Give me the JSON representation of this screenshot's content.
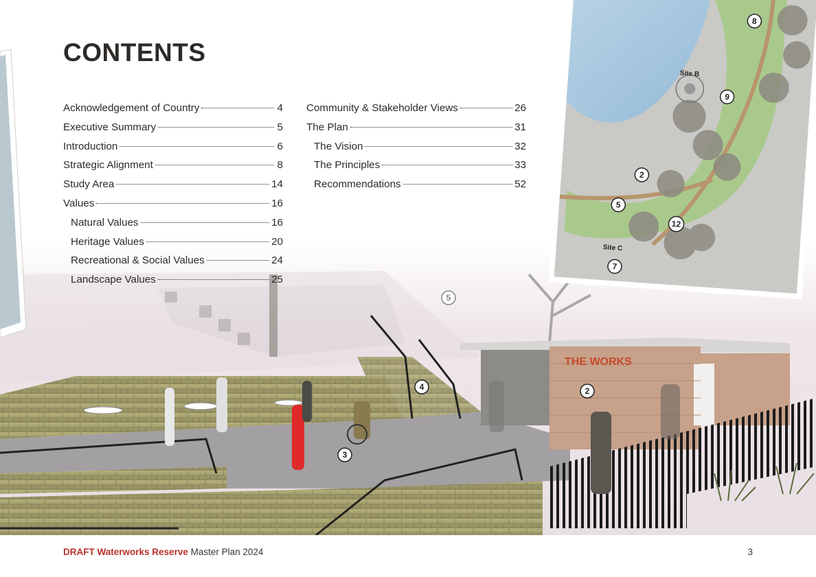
{
  "heading": "CONTENTS",
  "toc_left": [
    {
      "title": "Acknowledgement of Country",
      "page": "4",
      "sub": false
    },
    {
      "title": "Executive Summary",
      "page": "5",
      "sub": false
    },
    {
      "title": "Introduction",
      "page": "6",
      "sub": false
    },
    {
      "title": "Strategic Alignment",
      "page": "8",
      "sub": false
    },
    {
      "title": "Study Area",
      "page": "14",
      "sub": false
    },
    {
      "title": "Values",
      "page": "16",
      "sub": false
    },
    {
      "title": "Natural Values",
      "page": "16",
      "sub": true
    },
    {
      "title": "Heritage Values",
      "page": "20",
      "sub": true
    },
    {
      "title": "Recreational & Social Values",
      "page": "24",
      "sub": true
    },
    {
      "title": "Landscape Values",
      "page": "25",
      "sub": true
    }
  ],
  "toc_right": [
    {
      "title": "Community & Stakeholder Views",
      "page": "26",
      "sub": false
    },
    {
      "title": "The Plan",
      "page": "31",
      "sub": false
    },
    {
      "title": "The Vision",
      "page": "32",
      "sub": true
    },
    {
      "title": "The Principles",
      "page": "33",
      "sub": true
    },
    {
      "title": "Recommendations",
      "page": "52",
      "sub": true
    }
  ],
  "illustration": {
    "building_sign": "THE WORKS",
    "markers": [
      "5",
      "4",
      "2",
      "3"
    ]
  },
  "site_map": {
    "labels": [
      "Site B",
      "Site C"
    ],
    "markers": [
      "8",
      "9",
      "2",
      "5",
      "12",
      "7"
    ]
  },
  "footer": {
    "draft": "DRAFT",
    "project": "Waterworks Reserve",
    "rest": "Master Plan 2024",
    "page_number": "3"
  },
  "colors": {
    "accent": "#b8302b",
    "text": "#2e2a27"
  }
}
